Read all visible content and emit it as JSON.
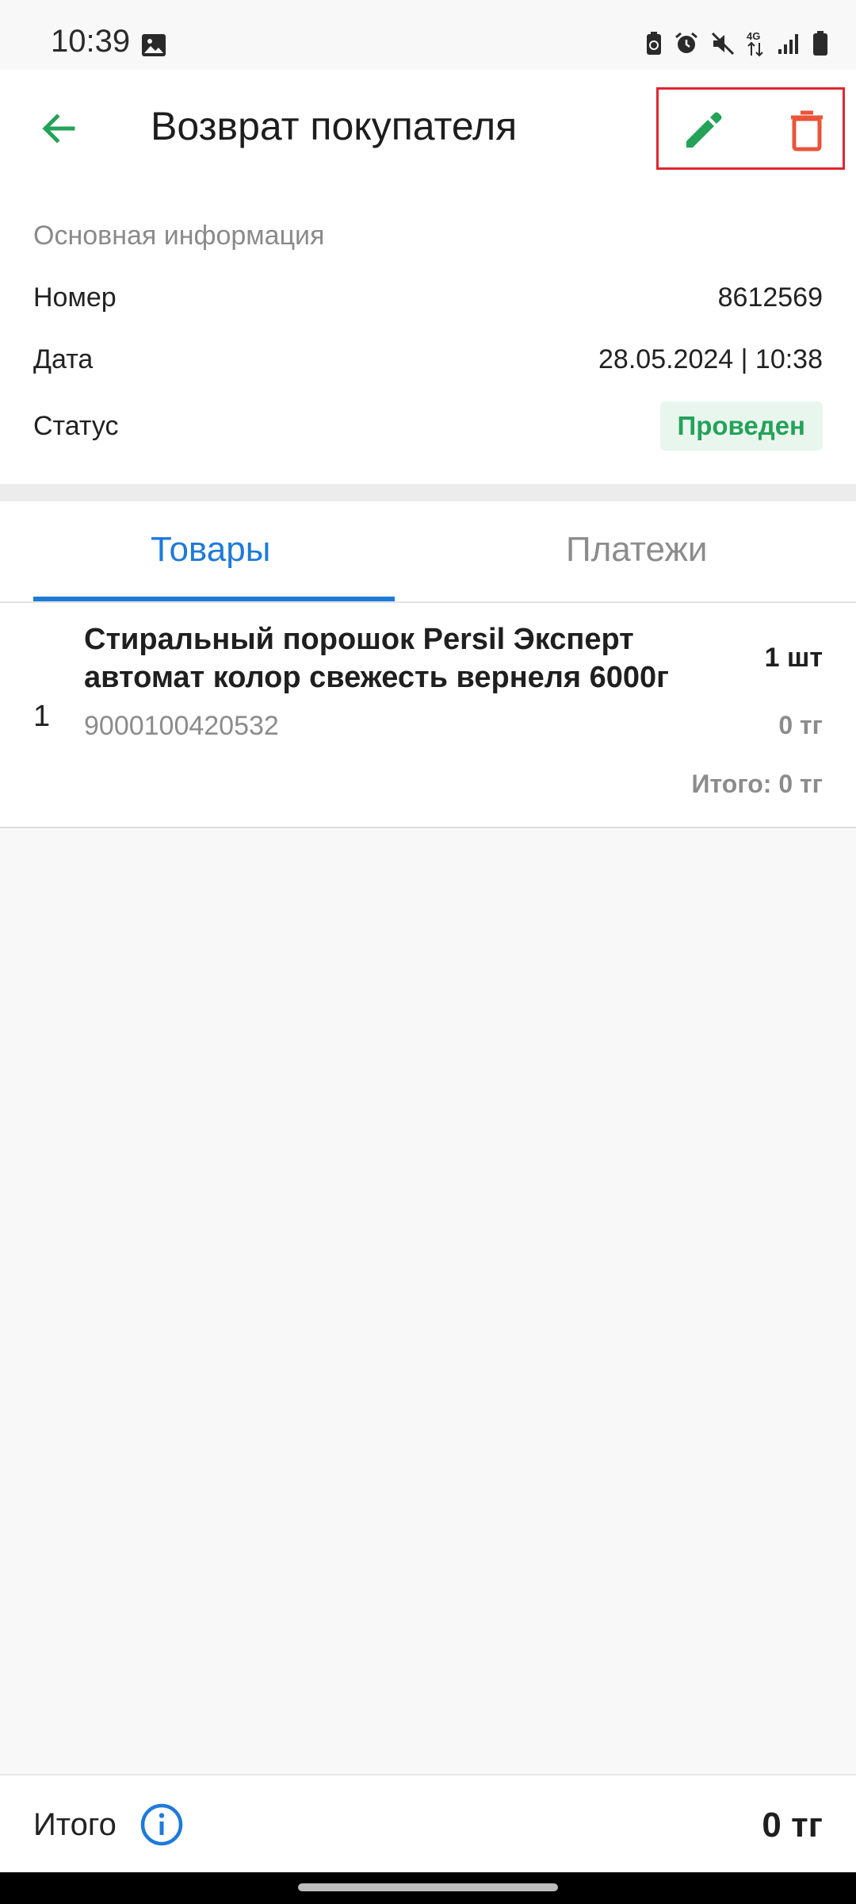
{
  "status_bar": {
    "time": "10:39",
    "network": "4G",
    "icons": [
      "image-icon",
      "battery-saver-icon",
      "alarm-icon",
      "mute-icon",
      "network-icon",
      "signal-icon",
      "battery-icon"
    ]
  },
  "header": {
    "title": "Возврат покупателя",
    "icons": [
      "back-arrow-icon",
      "edit-pencil-icon",
      "trash-icon"
    ]
  },
  "info": {
    "heading": "Основная информация",
    "number_label": "Номер",
    "number_value": "8612569",
    "date_label": "Дата",
    "date_value": "28.05.2024 | 10:38",
    "status_label": "Статус",
    "status_value": "Проведен"
  },
  "tabs": [
    {
      "label": "Товары",
      "active": true
    },
    {
      "label": "Платежи",
      "active": false
    }
  ],
  "items": [
    {
      "index": "1",
      "name": "Стиральный порошок Persil Эксперт автомат колор свежесть вернеля 6000г",
      "barcode": "9000100420532",
      "quantity": "1 шт",
      "price": "0 тг",
      "total": "Итого: 0 тг"
    }
  ],
  "footer": {
    "label": "Итого",
    "value": "0 тг"
  },
  "colors": {
    "accent_green": "#25a25a",
    "accent_blue": "#1f7ad8",
    "delete_red": "#e8553b",
    "highlight_box": "#e0262f"
  }
}
